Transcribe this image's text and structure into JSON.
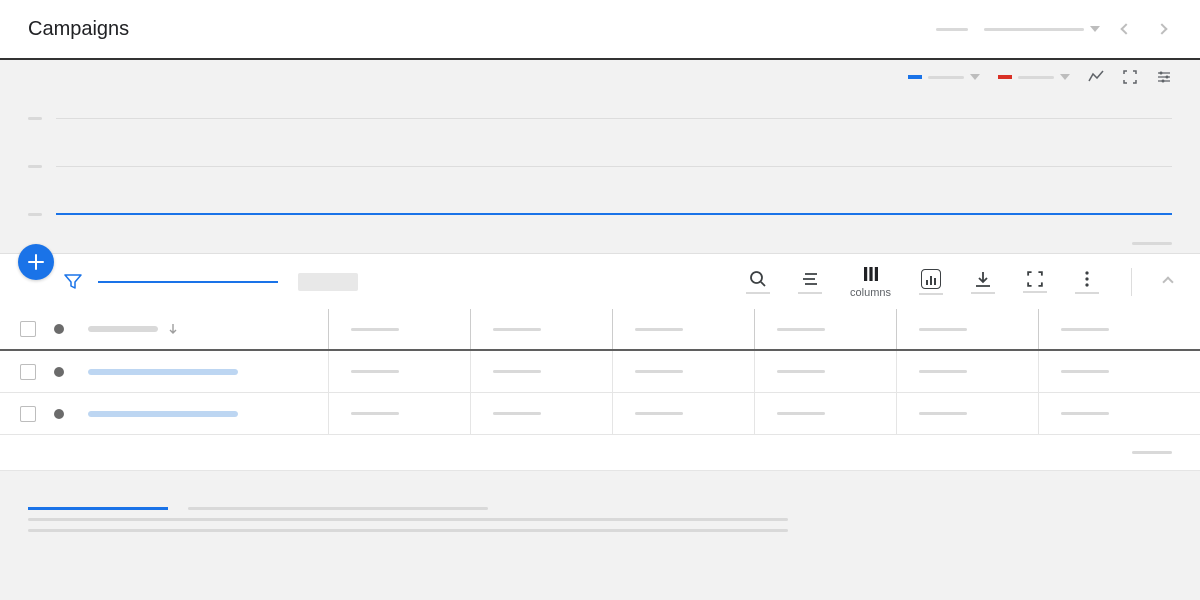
{
  "header": {
    "title": "Campaigns"
  },
  "legend": {
    "series1_color": "#1a73e8",
    "series2_color": "#d93025"
  },
  "toolbar": {
    "columns_label": "columns"
  },
  "table": {
    "rows": [
      {
        "status": "enabled"
      },
      {
        "status": "enabled"
      },
      {
        "status": "enabled"
      }
    ]
  }
}
